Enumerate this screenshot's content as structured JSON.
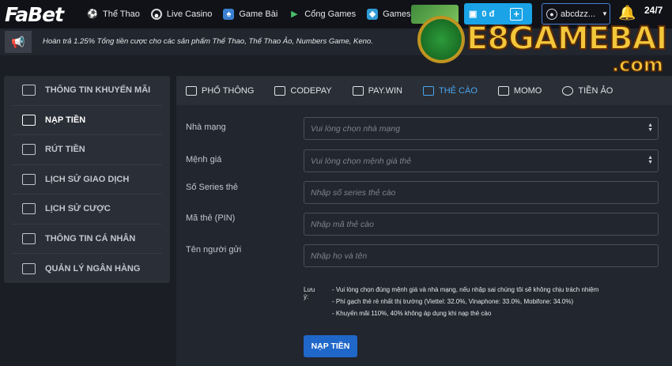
{
  "header": {
    "logo": "FaBet",
    "nav": [
      {
        "label": "Thể Thao",
        "icon": "soccer-ball-icon"
      },
      {
        "label": "Live Casino",
        "icon": "casino-chip-icon"
      },
      {
        "label": "Game Bài",
        "icon": "cards-icon"
      },
      {
        "label": "Cổng Games",
        "icon": "gamepad-icon"
      },
      {
        "label": "Games Nhanh",
        "icon": "dice-icon"
      }
    ],
    "balance": "0 đ",
    "username": "abcdzz...",
    "support": "24/7"
  },
  "notice": {
    "text": "Hoàn trả 1.25% Tổng tiền cược cho các sản phẩm Thể Thao, Thể Thao Ảo, Numbers Game, Keno."
  },
  "watermark": {
    "text": "E8GAMEBAI",
    "suffix": ".com"
  },
  "sidebar": {
    "items": [
      {
        "label": "Thông tin khuyến mãi",
        "icon": "wallet-icon"
      },
      {
        "label": "Nạp tiền",
        "icon": "deposit-icon"
      },
      {
        "label": "Rút tiền",
        "icon": "withdraw-icon"
      },
      {
        "label": "Lịch sử giao dịch",
        "icon": "transaction-history-icon"
      },
      {
        "label": "Lịch sử cược",
        "icon": "bet-history-icon"
      },
      {
        "label": "Thông tin cá nhân",
        "icon": "user-icon"
      },
      {
        "label": "Quản lý ngân hàng",
        "icon": "bank-card-icon"
      }
    ],
    "active_index": 1
  },
  "tabs": [
    {
      "label": "Phổ thông",
      "icon": "bank-icon"
    },
    {
      "label": "CodePay",
      "icon": "codepay-icon"
    },
    {
      "label": "Pay.Win",
      "icon": "paywin-icon"
    },
    {
      "label": "Thẻ cào",
      "icon": "card-icon"
    },
    {
      "label": "MoMo",
      "icon": "momo-icon"
    },
    {
      "label": "Tiền ảo",
      "icon": "bitcoin-icon"
    }
  ],
  "active_tab": 3,
  "form": {
    "carrier_label": "Nhà mạng",
    "carrier_placeholder": "Vui lòng chọn nhà mạng",
    "value_label": "Mệnh giá",
    "value_placeholder": "Vui lòng chọn mệnh giá thẻ",
    "serial_label": "Số Series thẻ",
    "serial_placeholder": "Nhập số series thẻ cào",
    "pin_label": "Mã thẻ (PIN)",
    "pin_placeholder": "Nhập mã thẻ cào",
    "sender_label": "Tên người gửi",
    "sender_placeholder": "Nhập họ và tên",
    "note_label": "Lưu ý:",
    "notes": [
      "- Vui lòng chọn đúng mệnh giá và nhà mạng, nếu nhập sai chúng tôi sẽ không chịu trách nhiệm",
      "- Phí gạch thẻ rẻ nhất thị trường (Viettel: 32.0%, Vinaphone: 33.0%, Mobifone: 34.0%)",
      "- Khuyến mãi 110%, 40% không áp dụng khi nạp thẻ cào"
    ],
    "submit_label": "NẠP TIỀN"
  }
}
